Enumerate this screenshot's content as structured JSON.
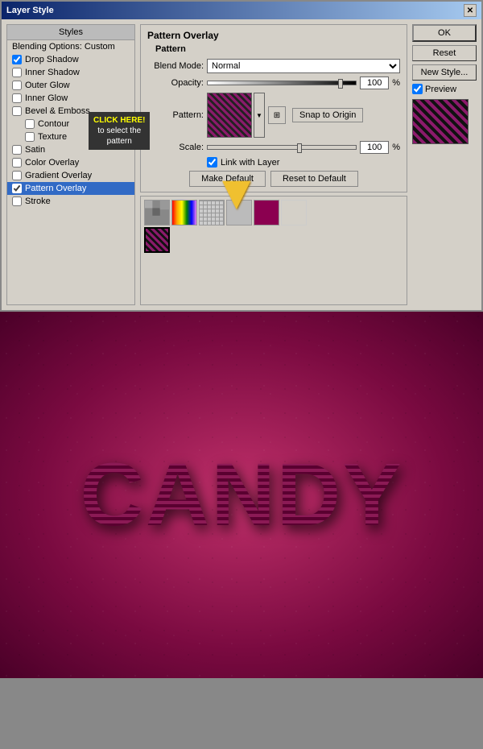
{
  "dialog": {
    "title": "Layer Style",
    "close_label": "✕"
  },
  "left_panel": {
    "header": "Styles",
    "items": [
      {
        "label": "Blending Options: Custom",
        "checked": null,
        "active": false,
        "indent": 0
      },
      {
        "label": "Drop Shadow",
        "checked": true,
        "active": false,
        "indent": 0
      },
      {
        "label": "Inner Shadow",
        "checked": false,
        "active": false,
        "indent": 0
      },
      {
        "label": "Outer Glow",
        "checked": false,
        "active": false,
        "indent": 0
      },
      {
        "label": "Inner Glow",
        "checked": false,
        "active": false,
        "indent": 0
      },
      {
        "label": "Bevel & Emboss",
        "checked": false,
        "active": false,
        "indent": 0
      },
      {
        "label": "Contour",
        "checked": false,
        "active": false,
        "indent": 1
      },
      {
        "label": "Texture",
        "checked": false,
        "active": false,
        "indent": 1
      },
      {
        "label": "Satin",
        "checked": false,
        "active": false,
        "indent": 0
      },
      {
        "label": "Color Overlay",
        "checked": false,
        "active": false,
        "indent": 0
      },
      {
        "label": "Gradient Overlay",
        "checked": false,
        "active": false,
        "indent": 0
      },
      {
        "label": "Pattern Overlay",
        "checked": true,
        "active": true,
        "indent": 0
      },
      {
        "label": "Stroke",
        "checked": false,
        "active": false,
        "indent": 0
      }
    ]
  },
  "pattern_overlay": {
    "section_title": "Pattern Overlay",
    "subsection_title": "Pattern",
    "blend_mode_label": "Blend Mode:",
    "blend_mode_value": "Normal",
    "opacity_label": "Opacity:",
    "opacity_value": "100",
    "opacity_unit": "%",
    "pattern_label": "Pattern:",
    "snap_to_origin_label": "Snap to Origin",
    "scale_label": "Scale:",
    "scale_value": "100",
    "scale_unit": "%",
    "link_with_layer_label": "Link with Layer",
    "make_default_label": "Make Default",
    "reset_to_default_label": "Reset to Default"
  },
  "right_panel": {
    "ok_label": "OK",
    "reset_label": "Reset",
    "new_style_label": "New Style...",
    "preview_label": "Preview"
  },
  "annotation": {
    "tooltip_line1": "CLICK HERE!",
    "tooltip_line2": "to select the",
    "tooltip_line3": "pattern"
  },
  "canvas": {
    "text": "CANDY"
  },
  "pattern_swatches": [
    {
      "id": 1,
      "type": "noise"
    },
    {
      "id": 2,
      "type": "rainbow"
    },
    {
      "id": 3,
      "type": "crosshatch"
    },
    {
      "id": 4,
      "type": "gray"
    },
    {
      "id": 5,
      "type": "solid-pink"
    },
    {
      "id": 6,
      "type": "stripe-selected"
    }
  ]
}
